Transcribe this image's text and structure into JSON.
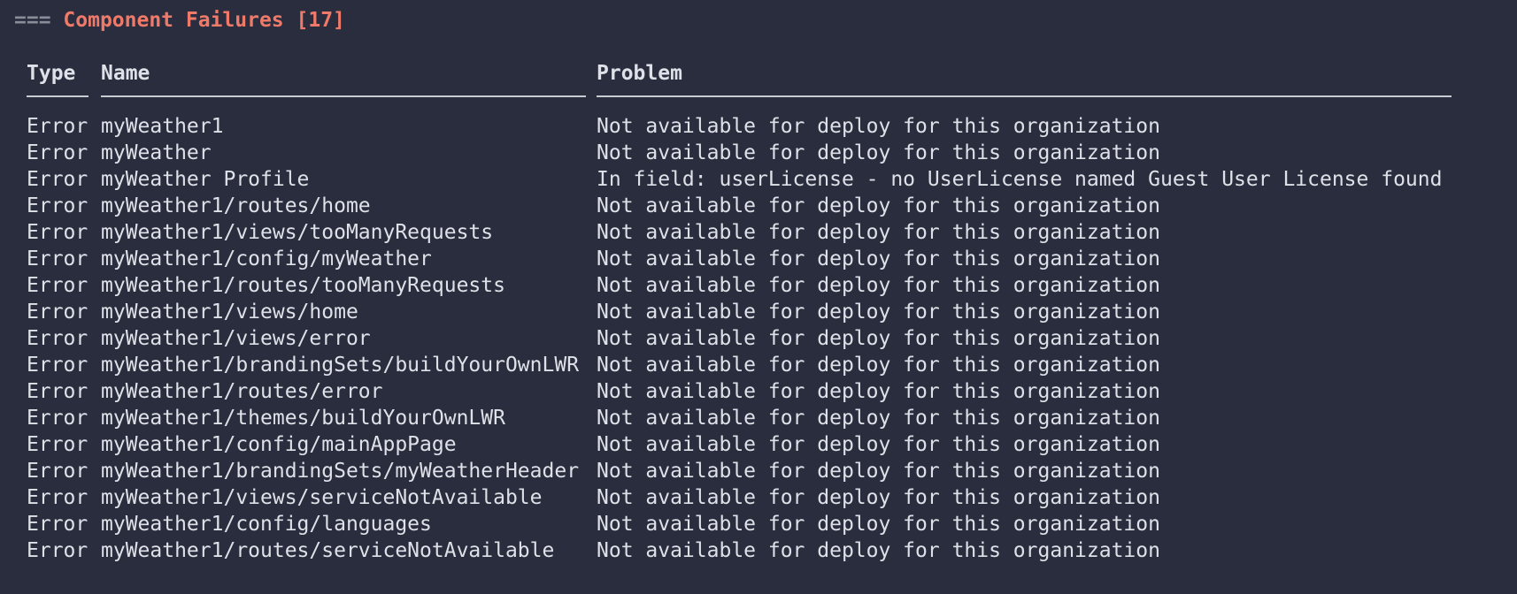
{
  "header": {
    "prefix": "===",
    "title": "Component Failures [17]"
  },
  "columns": {
    "type": "Type",
    "name": "Name",
    "problem": "Problem"
  },
  "rows": [
    {
      "type": "Error",
      "name": "myWeather1",
      "problem": "Not available for deploy for this organization"
    },
    {
      "type": "Error",
      "name": "myWeather",
      "problem": "Not available for deploy for this organization"
    },
    {
      "type": "Error",
      "name": "myWeather Profile",
      "problem": "In field: userLicense - no UserLicense named Guest User License found"
    },
    {
      "type": "Error",
      "name": "myWeather1/routes/home",
      "problem": "Not available for deploy for this organization"
    },
    {
      "type": "Error",
      "name": "myWeather1/views/tooManyRequests",
      "problem": "Not available for deploy for this organization"
    },
    {
      "type": "Error",
      "name": "myWeather1/config/myWeather",
      "problem": "Not available for deploy for this organization"
    },
    {
      "type": "Error",
      "name": "myWeather1/routes/tooManyRequests",
      "problem": "Not available for deploy for this organization"
    },
    {
      "type": "Error",
      "name": "myWeather1/views/home",
      "problem": "Not available for deploy for this organization"
    },
    {
      "type": "Error",
      "name": "myWeather1/views/error",
      "problem": "Not available for deploy for this organization"
    },
    {
      "type": "Error",
      "name": "myWeather1/brandingSets/buildYourOwnLWR",
      "problem": "Not available for deploy for this organization"
    },
    {
      "type": "Error",
      "name": "myWeather1/routes/error",
      "problem": "Not available for deploy for this organization"
    },
    {
      "type": "Error",
      "name": "myWeather1/themes/buildYourOwnLWR",
      "problem": "Not available for deploy for this organization"
    },
    {
      "type": "Error",
      "name": "myWeather1/config/mainAppPage",
      "problem": "Not available for deploy for this organization"
    },
    {
      "type": "Error",
      "name": "myWeather1/brandingSets/myWeatherHeader",
      "problem": "Not available for deploy for this organization"
    },
    {
      "type": "Error",
      "name": "myWeather1/views/serviceNotAvailable",
      "problem": "Not available for deploy for this organization"
    },
    {
      "type": "Error",
      "name": "myWeather1/config/languages",
      "problem": "Not available for deploy for this organization"
    },
    {
      "type": "Error",
      "name": "myWeather1/routes/serviceNotAvailable",
      "problem": "Not available for deploy for this organization"
    }
  ]
}
